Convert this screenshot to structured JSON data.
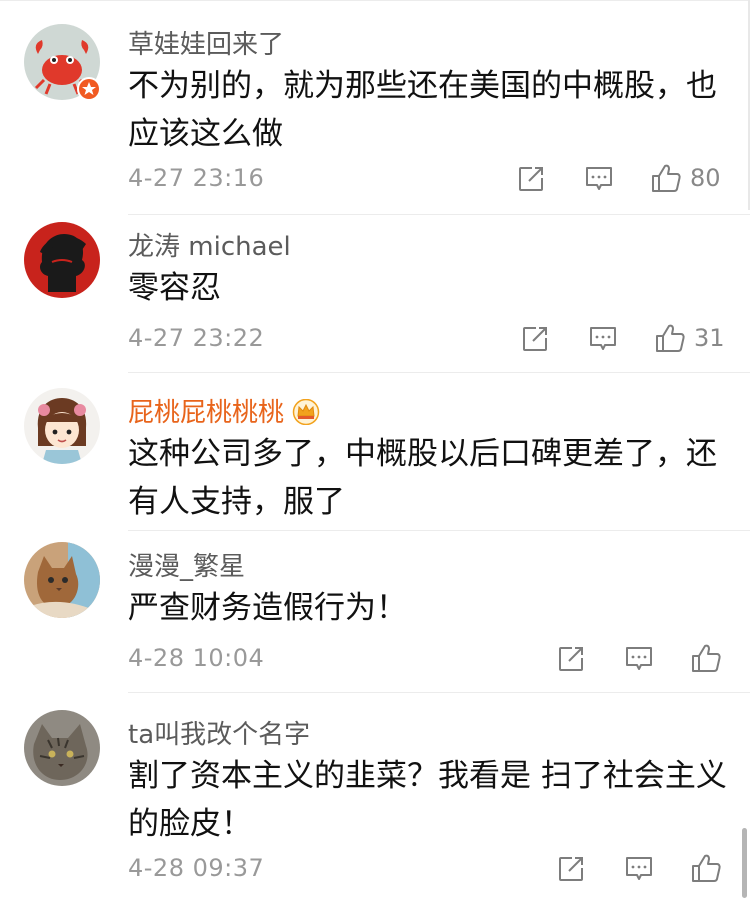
{
  "comments": [
    {
      "user": "草娃娃回来了",
      "text": "不为别的，就为那些还在美国的中概股，也应该这么做",
      "time": "4-27 23:16",
      "likes": "80",
      "avatar_icon": "crab-avatar",
      "badge": "vip-badge"
    },
    {
      "user": "龙涛 michael",
      "text": "零容忍",
      "time": "4-27 23:22",
      "likes": "31",
      "avatar_icon": "che-portrait-avatar"
    },
    {
      "user": "屁桃屁桃桃桃",
      "text": "这种公司多了，中概股以后口碑更差了，还有人支持，服了",
      "avatar_icon": "cartoon-girl-avatar",
      "badge": "crown-icon"
    },
    {
      "user": "漫漫_繁星",
      "text": "严查财务造假行为！",
      "time": "4-28 10:04",
      "avatar_icon": "cat-avatar"
    },
    {
      "user": "ta叫我改个名字",
      "text": "割了资本主义的韭菜？我看是 扫了社会主义的脸皮！",
      "time": "4-28 09:37",
      "avatar_icon": "tabby-cat-avatar"
    }
  ],
  "colors": {
    "accent": "#e8641b",
    "text": "#111111",
    "meta": "#999999"
  },
  "icons": {
    "share": "share-icon",
    "reply": "comment-icon",
    "like": "thumbs-up-icon"
  }
}
